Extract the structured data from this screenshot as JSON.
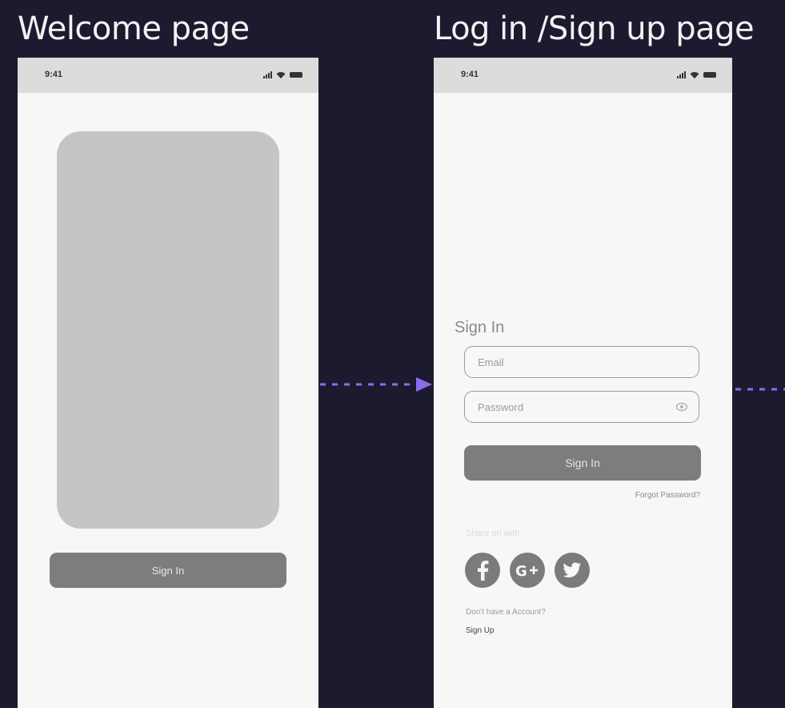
{
  "titles": {
    "welcome": "Welcome page",
    "login": "Log in /Sign up page"
  },
  "status_bar": {
    "time": "9:41"
  },
  "welcome": {
    "signin_label": "Sign In"
  },
  "login": {
    "heading": "Sign In",
    "email_placeholder": "Email",
    "password_placeholder": "Password",
    "signin_label": "Sign In",
    "forgot_password": "Forgot Password?",
    "share_label": "Share on with",
    "no_account": "Don't have a Account?",
    "signup_label": "Sign Up",
    "social_icons": [
      "facebook-icon",
      "google-plus-icon",
      "twitter-icon"
    ]
  },
  "colors": {
    "background": "#1c1a2e",
    "screen": "#f7f7f7",
    "status_bar": "#dcdcdc",
    "placeholder_image": "#c5c5c5",
    "button": "#7d7d7d",
    "connector": "#8b6cf0"
  }
}
